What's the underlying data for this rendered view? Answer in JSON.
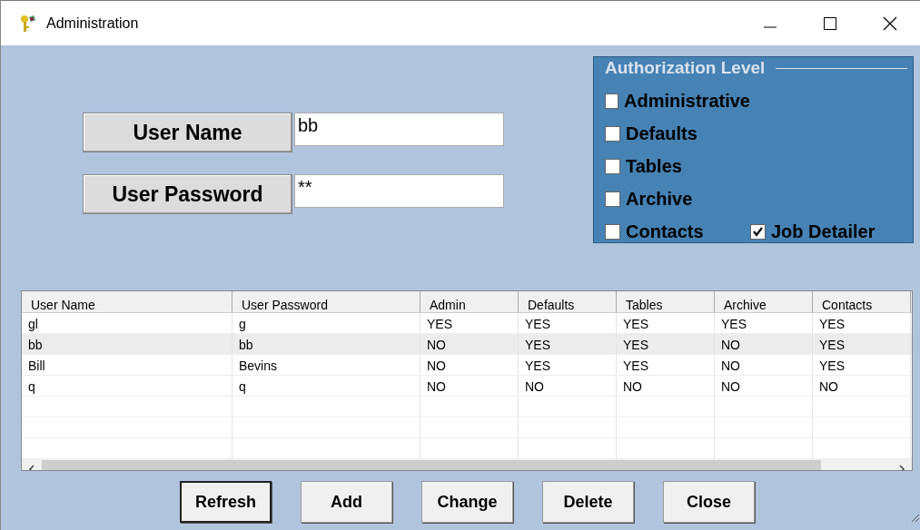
{
  "window": {
    "title": "Administration"
  },
  "user_name": {
    "label": "User Name",
    "value": "bb"
  },
  "user_password": {
    "label": "User Password",
    "value": "**"
  },
  "authorization": {
    "title": "Authorization Level",
    "rows": [
      [
        {
          "label": "Administrative",
          "checked": false
        }
      ],
      [
        {
          "label": "Defaults",
          "checked": false
        }
      ],
      [
        {
          "label": "Tables",
          "checked": false
        }
      ],
      [
        {
          "label": "Archive",
          "checked": false
        }
      ],
      [
        {
          "label": "Contacts",
          "checked": false
        },
        {
          "label": "Job Detailer",
          "checked": true
        }
      ]
    ]
  },
  "table": {
    "columns": [
      "User Name",
      "User Password",
      "Admin",
      "Defaults",
      "Tables",
      "Archive",
      "Contacts"
    ],
    "rows": [
      {
        "cells": [
          "gl",
          "g",
          "YES",
          "YES",
          "YES",
          "YES",
          "YES"
        ],
        "selected": false
      },
      {
        "cells": [
          "bb",
          "bb",
          "NO",
          "YES",
          "YES",
          "NO",
          "YES"
        ],
        "selected": true
      },
      {
        "cells": [
          "Bill",
          "Bevins",
          "NO",
          "YES",
          "YES",
          "NO",
          "YES"
        ],
        "selected": false
      },
      {
        "cells": [
          "q",
          "q",
          "NO",
          "NO",
          "NO",
          "NO",
          "NO"
        ],
        "selected": false
      }
    ]
  },
  "buttons": [
    {
      "label": "Refresh",
      "default": true
    },
    {
      "label": "Add",
      "default": false
    },
    {
      "label": "Change",
      "default": false
    },
    {
      "label": "Delete",
      "default": false
    },
    {
      "label": "Close",
      "default": false
    }
  ]
}
